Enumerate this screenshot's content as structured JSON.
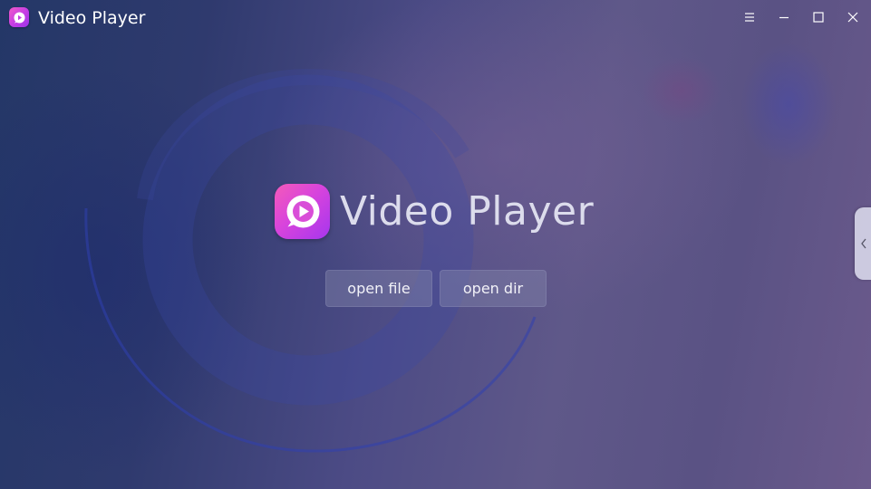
{
  "window": {
    "title": "Video Player",
    "icon": "video-player-app-icon"
  },
  "titlebar": {
    "menu_icon": "hamburger-menu-icon",
    "minimize_icon": "minimize-icon",
    "maximize_icon": "maximize-icon",
    "close_icon": "close-icon"
  },
  "main": {
    "app_name": "Video Player",
    "open_file_label": "open file",
    "open_dir_label": "open dir"
  },
  "side_panel": {
    "toggle_icon": "chevron-left-icon"
  },
  "colors": {
    "icon_gradient_start": "#f45ab9",
    "icon_gradient_end": "#a636ee",
    "background_left": "#243767",
    "background_right": "#6b5a8c"
  }
}
